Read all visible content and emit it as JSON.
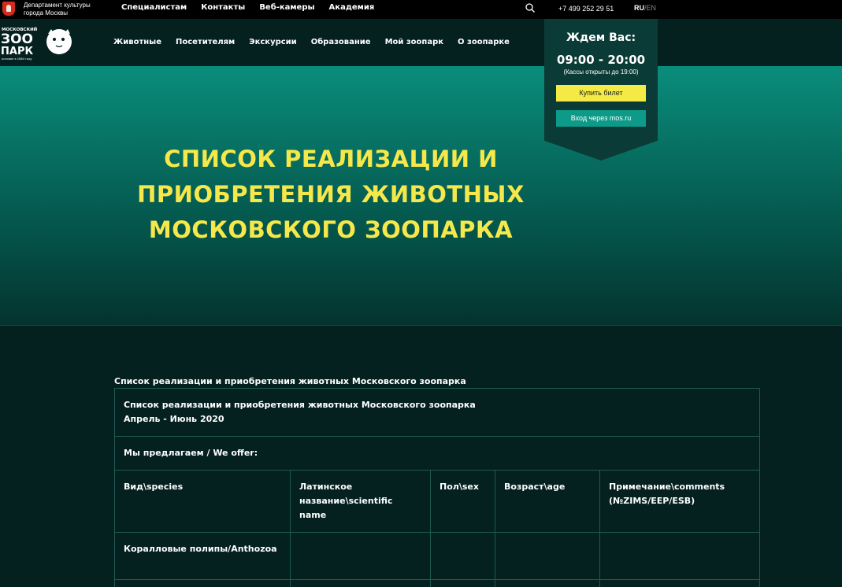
{
  "topbar": {
    "dept_line1": "Департамент культуры",
    "dept_line2": "города Москвы",
    "nav": [
      "Специалистам",
      "Контакты",
      "Веб-камеры",
      "Академия"
    ],
    "phone": "+7 499 252 29 51",
    "lang_ru": "RU",
    "lang_sep": "/",
    "lang_en": "EN"
  },
  "logo": {
    "line1": "МОСКОВСКИЙ",
    "line2": "ЗОО",
    "line3": "ПАРК",
    "line4": "основан в 1864 году"
  },
  "mainnav": [
    "Животные",
    "Посетителям",
    "Экскурсии",
    "Образование",
    "Мой зоопарк",
    "О зоопарке"
  ],
  "hours": {
    "heading": "Ждем Вас:",
    "time": "09:00 - 20:00",
    "note": "(Кассы открыты до 19:00)",
    "buy_label": "Купить билет",
    "mos_label": "Вход через mos.ru"
  },
  "hero": {
    "title_line1": "СПИСОК РЕАЛИЗАЦИИ И",
    "title_line2": "ПРИОБРЕТЕНИЯ ЖИВОТНЫХ",
    "title_line3": "МОСКОВСКОГО ЗООПАРКА"
  },
  "content": {
    "heading": "Список реализации и приобретения животных Московского зоопарка",
    "intro_line1": "Список реализации и приобретения животных Московского зоопарка",
    "intro_line2": "Апрель - Июнь 2020",
    "offer_label": "Мы предлагаем / We offer:",
    "columns": [
      "Вид\\species",
      "Латинское название\\scientific name",
      "Пол\\sex",
      "Возраст\\age",
      "Примечание\\comments (№ZIMS/EEP/ESB)"
    ],
    "category_row": "Коралловые полипы/Anthozoa"
  },
  "colors": {
    "accent_yellow": "#f6e84a",
    "button_teal": "#0e9a88",
    "background": "#04201f"
  }
}
